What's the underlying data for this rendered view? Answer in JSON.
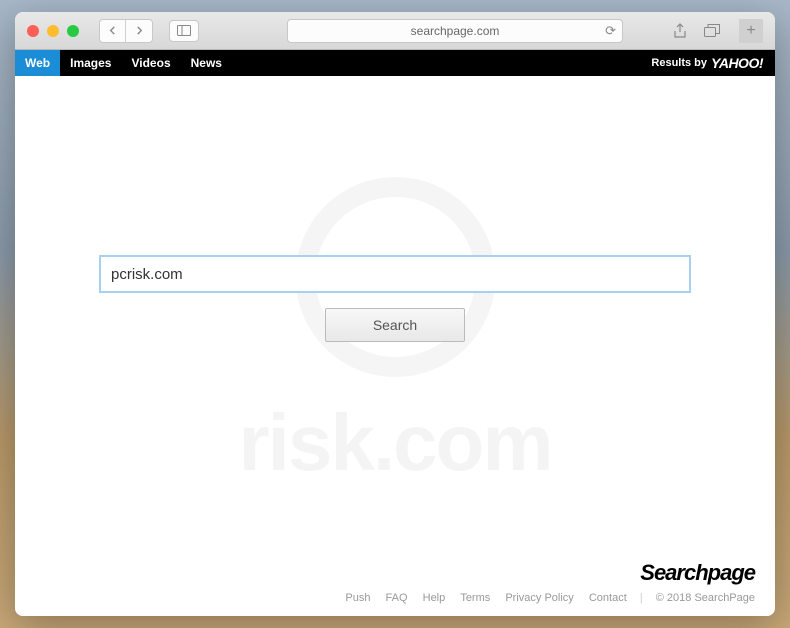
{
  "browser": {
    "address": "searchpage.com"
  },
  "nav": {
    "items": [
      {
        "label": "Web",
        "active": true
      },
      {
        "label": "Images",
        "active": false
      },
      {
        "label": "Videos",
        "active": false
      },
      {
        "label": "News",
        "active": false
      }
    ],
    "results_by": "Results by",
    "provider": "YAHOO!"
  },
  "search": {
    "value": "pcrisk.com",
    "button_label": "Search"
  },
  "brand": "Searchpage",
  "footer": {
    "links": [
      "Push",
      "FAQ",
      "Help",
      "Terms",
      "Privacy Policy",
      "Contact"
    ],
    "copyright": "© 2018 SearchPage"
  },
  "watermark": {
    "text": "risk.com"
  }
}
